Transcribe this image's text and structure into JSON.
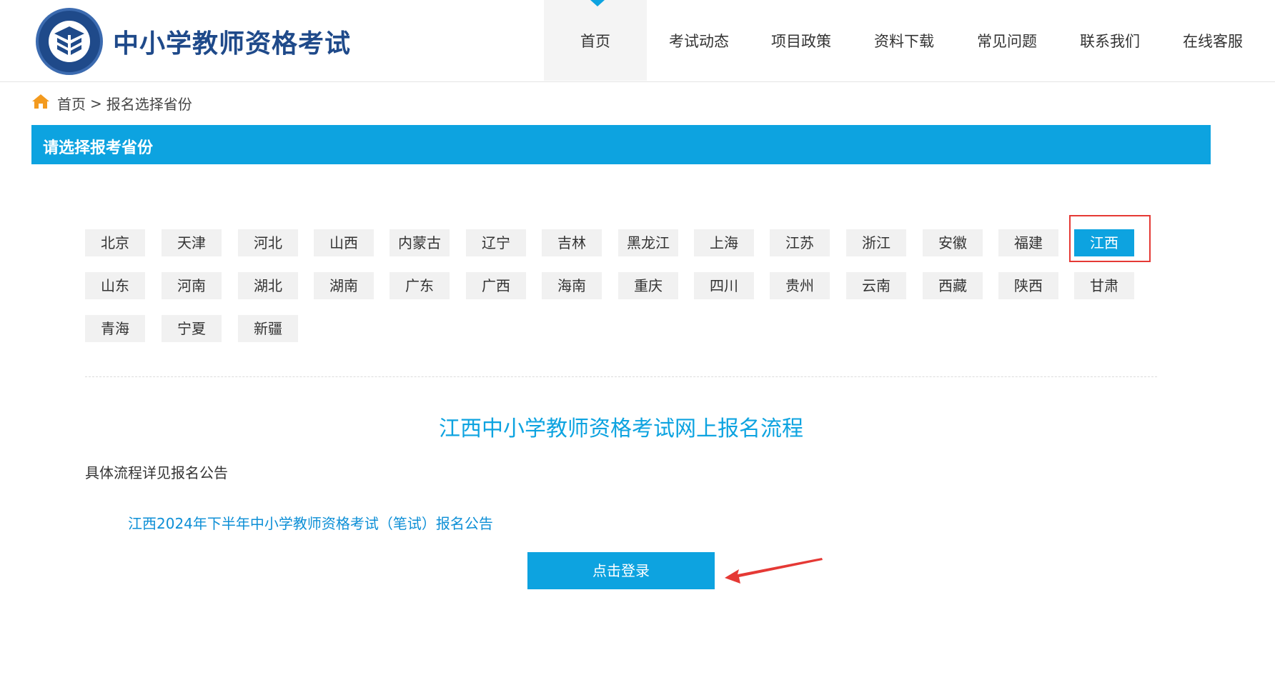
{
  "header": {
    "site_title": "中小学教师资格考试",
    "nav": [
      {
        "label": "首页",
        "active": true
      },
      {
        "label": "考试动态"
      },
      {
        "label": "项目政策"
      },
      {
        "label": "资料下载"
      },
      {
        "label": "常见问题"
      },
      {
        "label": "联系我们"
      },
      {
        "label": "在线客服"
      }
    ]
  },
  "breadcrumb": {
    "icon": "home-icon",
    "home": "首页",
    "separator": ">",
    "current": "报名选择省份"
  },
  "banner": {
    "title": "请选择报考省份"
  },
  "provinces": [
    {
      "label": "北京"
    },
    {
      "label": "天津"
    },
    {
      "label": "河北"
    },
    {
      "label": "山西"
    },
    {
      "label": "内蒙古"
    },
    {
      "label": "辽宁"
    },
    {
      "label": "吉林"
    },
    {
      "label": "黑龙江"
    },
    {
      "label": "上海"
    },
    {
      "label": "江苏"
    },
    {
      "label": "浙江"
    },
    {
      "label": "安徽"
    },
    {
      "label": "福建"
    },
    {
      "label": "江西",
      "selected": true
    },
    {
      "label": "山东"
    },
    {
      "label": "河南"
    },
    {
      "label": "湖北"
    },
    {
      "label": "湖南"
    },
    {
      "label": "广东"
    },
    {
      "label": "广西"
    },
    {
      "label": "海南"
    },
    {
      "label": "重庆"
    },
    {
      "label": "四川"
    },
    {
      "label": "贵州"
    },
    {
      "label": "云南"
    },
    {
      "label": "西藏"
    },
    {
      "label": "陕西"
    },
    {
      "label": "甘肃"
    },
    {
      "label": "青海"
    },
    {
      "label": "宁夏"
    },
    {
      "label": "新疆"
    }
  ],
  "flow": {
    "title": "江西中小学教师资格考试网上报名流程",
    "note": "具体流程详见报名公告",
    "announcement_link": "江西2024年下半年中小学教师资格考试（笔试）报名公告",
    "login_button": "点击登录"
  },
  "colors": {
    "accent": "#0da3e0",
    "brand": "#1f4a8a",
    "annotation": "#e53935"
  }
}
